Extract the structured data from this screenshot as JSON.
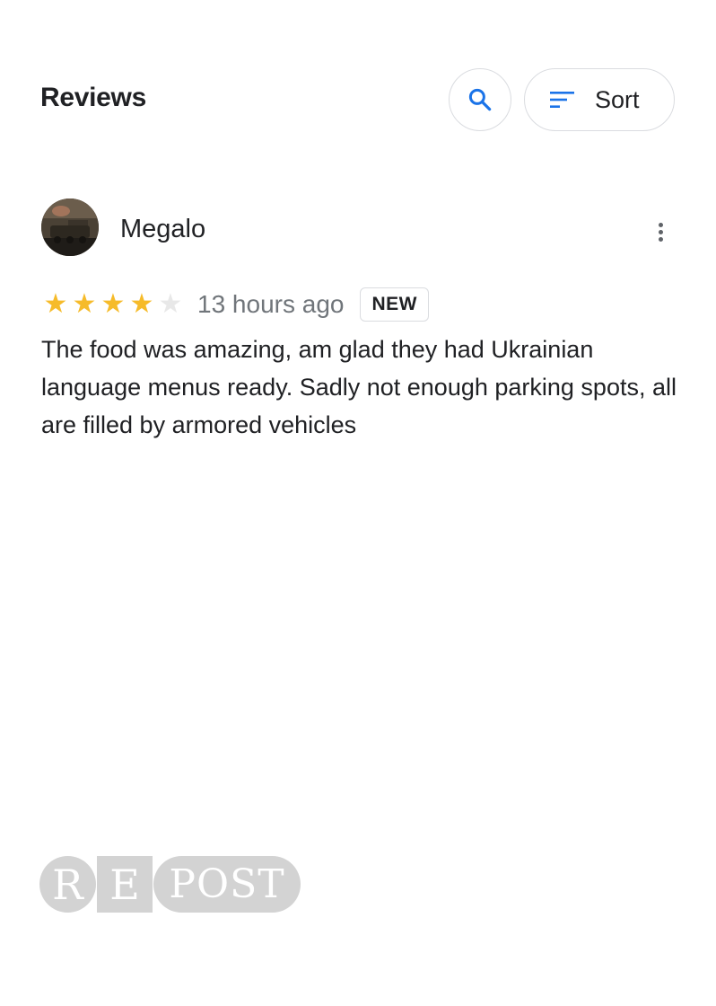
{
  "header": {
    "title": "Reviews",
    "search_icon": "search-icon",
    "sort_label": "Sort",
    "sort_icon": "sort-lines-icon"
  },
  "review": {
    "author": "Megalo",
    "rating": 4,
    "max_rating": 5,
    "time": "13 hours ago",
    "badge": "NEW",
    "text": "The food was amazing, am glad they had Ukrainian language menus ready. Sadly not enough parking spots, all are filled by armored vehicles",
    "more_icon": "more-vert-icon"
  },
  "watermark": {
    "parts": [
      "R",
      "E",
      "POST"
    ]
  },
  "colors": {
    "star_filled": "#f6bb2a",
    "star_empty": "#e8e8e8",
    "accent_blue": "#1a73e8",
    "muted_text": "#70757a",
    "border": "#dadce0"
  }
}
